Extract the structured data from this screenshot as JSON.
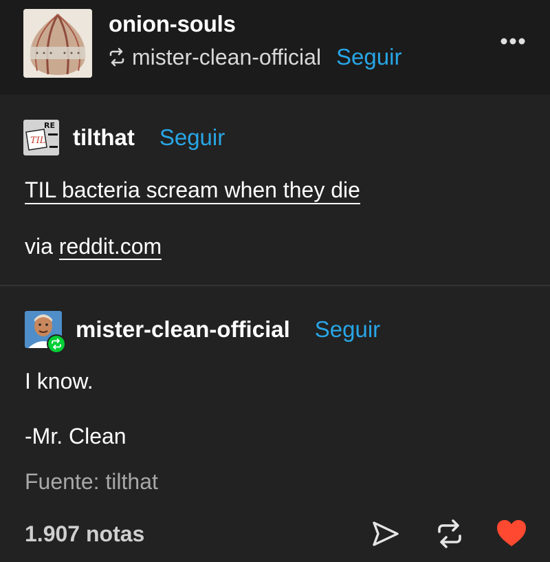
{
  "header": {
    "blog_name": "onion-souls",
    "reblogged_from": "mister-clean-official",
    "follow_label": "Seguir",
    "avatar_icon": "onion-avatar",
    "more_icon": "more-dots-icon"
  },
  "original_post": {
    "username": "tilthat",
    "follow_label": "Seguir",
    "title": "TIL bacteria scream when they die",
    "via_prefix": "via ",
    "via_link": "reddit.com"
  },
  "reblog": {
    "username": "mister-clean-official",
    "follow_label": "Seguir",
    "line1": "I know.",
    "line2": "-Mr. Clean"
  },
  "source": "Fuente: tilthat",
  "footer": {
    "notes": "1.907 notas",
    "share_icon": "share-icon",
    "reblog_icon": "reblog-icon",
    "like_icon": "heart-icon"
  },
  "colors": {
    "background": "#222222",
    "header_background": "#1b1b1b",
    "link_blue": "#28a6e6",
    "heart_red": "#ff4930",
    "reblog_badge_green": "#00cf35"
  }
}
